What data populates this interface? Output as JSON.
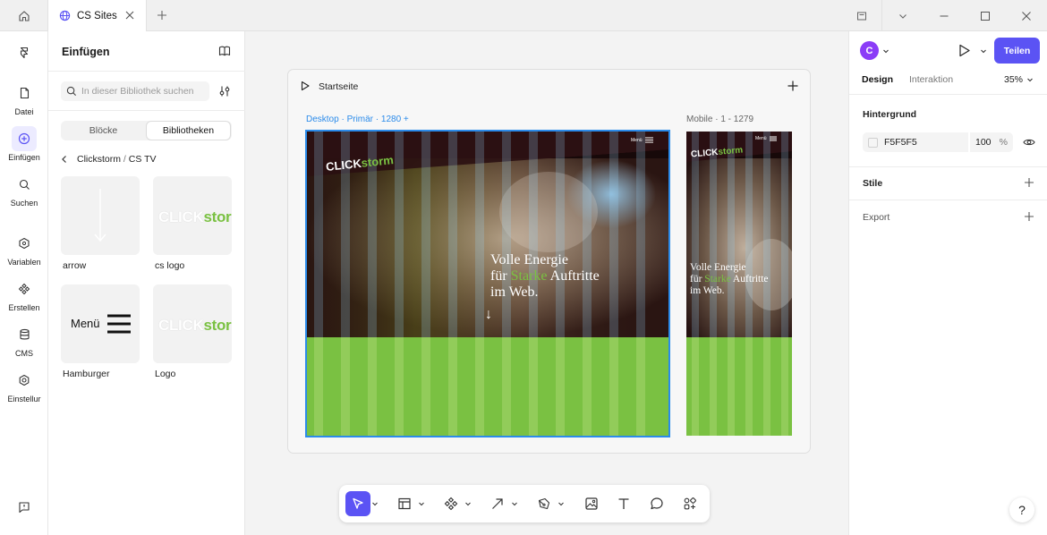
{
  "tabs": {
    "document_title": "CS Sites"
  },
  "rail": {
    "items": [
      {
        "label": "",
        "icon": "framer-logo-icon"
      },
      {
        "label": "Datei",
        "icon": "file-icon"
      },
      {
        "label": "Einfügen",
        "icon": "plus-circle-icon"
      },
      {
        "label": "Suchen",
        "icon": "search-icon"
      },
      {
        "label": "Variablen",
        "icon": "variables-icon"
      },
      {
        "label": "Erstellen",
        "icon": "components-icon"
      },
      {
        "label": "CMS",
        "icon": "database-icon"
      },
      {
        "label": "Einstellur",
        "icon": "gear-icon"
      }
    ]
  },
  "insert_panel": {
    "title": "Einfügen",
    "search_placeholder": "In dieser Bibliothek suchen",
    "segments": [
      "Blöcke",
      "Bibliotheken"
    ],
    "selected_segment": "Bibliotheken",
    "breadcrumb": {
      "parent": "Clickstorm",
      "separator": "/",
      "current": "CS TV"
    },
    "cards": [
      {
        "label": "arrow"
      },
      {
        "label": "cs logo",
        "logo_left": "CLICK",
        "logo_right": "storm"
      },
      {
        "label": "Hamburger",
        "menu_text": "Menü"
      },
      {
        "label": "Logo",
        "logo_left": "CLICK",
        "logo_right": "storm"
      }
    ]
  },
  "canvas": {
    "page_name": "Startseite",
    "desktop": {
      "label": "Desktop · Primär · 1280 +",
      "menu_text": "Menü",
      "logo_left": "CLICK",
      "logo_right": "storm",
      "hero_line1": "Volle Energie",
      "hero_line2_a": "für ",
      "hero_line2_hl": "Starke",
      "hero_line2_b": " Auftritte",
      "hero_line3": "im Web.",
      "down_arrow": "↓"
    },
    "mobile": {
      "label": "Mobile · 1 - 1279",
      "menu_text": "Menü",
      "logo_left": "CLICK",
      "logo_right": "storm",
      "hero_line1": "Volle Energie",
      "hero_line2_a": "für ",
      "hero_line2_hl": "Starke",
      "hero_line2_b": " Auftritte",
      "hero_line3": "im Web."
    }
  },
  "toolbar": {
    "tools": [
      "select-tool",
      "layout-tool",
      "components-tool",
      "arrow-tool",
      "pen-tool",
      "image-tool",
      "text-tool",
      "comment-tool",
      "add-elements-tool"
    ]
  },
  "right_panel": {
    "avatar_letter": "C",
    "share_label": "Teilen",
    "tabs": [
      "Design",
      "Interaktion"
    ],
    "zoom": "35%",
    "background_heading": "Hintergrund",
    "background_color": "F5F5F5",
    "background_opacity": "100",
    "opacity_unit": "%",
    "styles_heading": "Stile",
    "export_heading": "Export"
  },
  "help_label": "?",
  "colors": {
    "accent": "#5b53f4",
    "selection": "#2b8bea",
    "brand_green": "#7ac142",
    "avatar": "#8b3cf7"
  }
}
